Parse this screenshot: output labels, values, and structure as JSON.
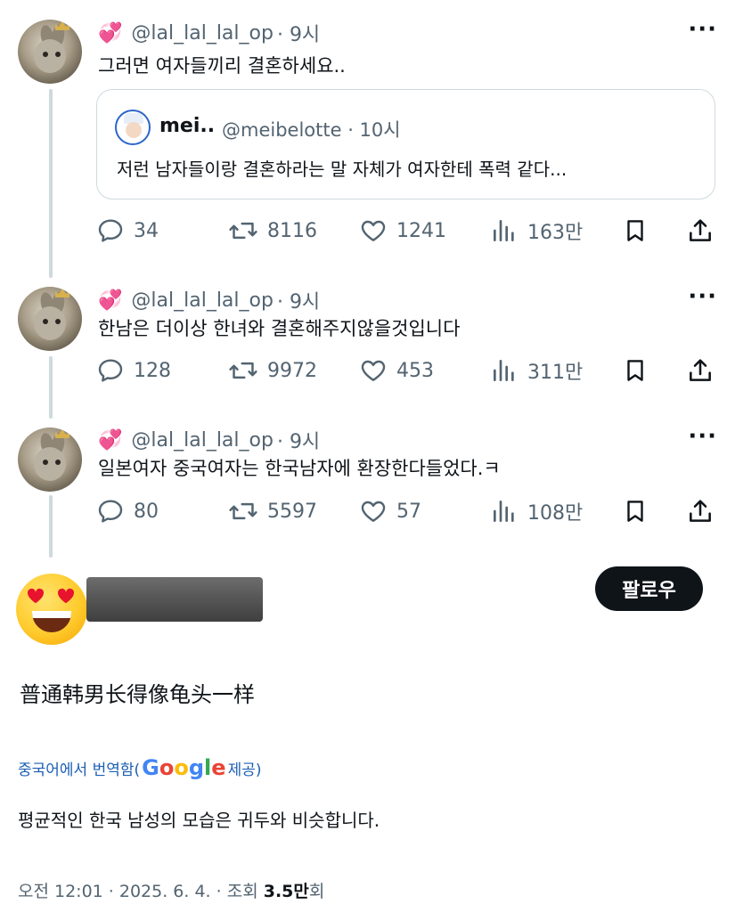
{
  "thread": [
    {
      "handle": "@lal_lal_lal_op",
      "time": "· 9시",
      "badge": "💞",
      "text": "그러면 여자들끼리 결혼하세요..",
      "quote": {
        "name": "mei..",
        "handle": "@meibelotte · 10시",
        "text": "저런 남자들이랑 결혼하라는 말 자체가 여자한테 폭력 같다..."
      },
      "replies": "34",
      "reposts": "8116",
      "likes": "1241",
      "views": "163만"
    },
    {
      "handle": "@lal_lal_lal_op",
      "time": "· 9시",
      "badge": "💞",
      "text": "한남은 더이상 한녀와 결혼해주지않을것입니다",
      "replies": "128",
      "reposts": "9972",
      "likes": "453",
      "views": "311만"
    },
    {
      "handle": "@lal_lal_lal_op",
      "time": "· 9시",
      "badge": "💞",
      "text": "일본여자 중국여자는 한국남자에 환장한다들었다.ㅋ",
      "replies": "80",
      "reposts": "5597",
      "likes": "57",
      "views": "108만"
    }
  ],
  "more_label": "···",
  "main": {
    "follow_label": "팔로우",
    "text": "普通韩男长得像龟头一样",
    "translate_prefix": "중국어에서 번역함(",
    "google_letters": [
      "G",
      "o",
      "o",
      "g",
      "l",
      "e"
    ],
    "translate_suffix": " 제공)",
    "translated_text": "평균적인 한국 남성의 모습은 귀두와 비슷합니다.",
    "meta_prefix": "오전 12:01 · 2025. 6. 4. · 조회 ",
    "meta_views": "3.5만",
    "meta_suffix": "회"
  },
  "colors": {
    "text": "#0f1419",
    "muted": "#536471",
    "border": "#cfd9de",
    "link": "#1d5fb3"
  }
}
